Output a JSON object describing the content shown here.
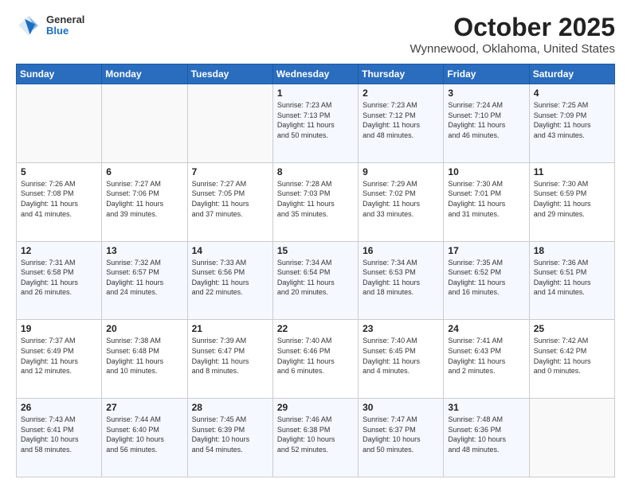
{
  "header": {
    "logo": {
      "general": "General",
      "blue": "Blue"
    },
    "title": "October 2025",
    "subtitle": "Wynnewood, Oklahoma, United States"
  },
  "weekdays": [
    "Sunday",
    "Monday",
    "Tuesday",
    "Wednesday",
    "Thursday",
    "Friday",
    "Saturday"
  ],
  "weeks": [
    [
      {
        "day": "",
        "info": ""
      },
      {
        "day": "",
        "info": ""
      },
      {
        "day": "",
        "info": ""
      },
      {
        "day": "1",
        "info": "Sunrise: 7:23 AM\nSunset: 7:13 PM\nDaylight: 11 hours\nand 50 minutes."
      },
      {
        "day": "2",
        "info": "Sunrise: 7:23 AM\nSunset: 7:12 PM\nDaylight: 11 hours\nand 48 minutes."
      },
      {
        "day": "3",
        "info": "Sunrise: 7:24 AM\nSunset: 7:10 PM\nDaylight: 11 hours\nand 46 minutes."
      },
      {
        "day": "4",
        "info": "Sunrise: 7:25 AM\nSunset: 7:09 PM\nDaylight: 11 hours\nand 43 minutes."
      }
    ],
    [
      {
        "day": "5",
        "info": "Sunrise: 7:26 AM\nSunset: 7:08 PM\nDaylight: 11 hours\nand 41 minutes."
      },
      {
        "day": "6",
        "info": "Sunrise: 7:27 AM\nSunset: 7:06 PM\nDaylight: 11 hours\nand 39 minutes."
      },
      {
        "day": "7",
        "info": "Sunrise: 7:27 AM\nSunset: 7:05 PM\nDaylight: 11 hours\nand 37 minutes."
      },
      {
        "day": "8",
        "info": "Sunrise: 7:28 AM\nSunset: 7:03 PM\nDaylight: 11 hours\nand 35 minutes."
      },
      {
        "day": "9",
        "info": "Sunrise: 7:29 AM\nSunset: 7:02 PM\nDaylight: 11 hours\nand 33 minutes."
      },
      {
        "day": "10",
        "info": "Sunrise: 7:30 AM\nSunset: 7:01 PM\nDaylight: 11 hours\nand 31 minutes."
      },
      {
        "day": "11",
        "info": "Sunrise: 7:30 AM\nSunset: 6:59 PM\nDaylight: 11 hours\nand 29 minutes."
      }
    ],
    [
      {
        "day": "12",
        "info": "Sunrise: 7:31 AM\nSunset: 6:58 PM\nDaylight: 11 hours\nand 26 minutes."
      },
      {
        "day": "13",
        "info": "Sunrise: 7:32 AM\nSunset: 6:57 PM\nDaylight: 11 hours\nand 24 minutes."
      },
      {
        "day": "14",
        "info": "Sunrise: 7:33 AM\nSunset: 6:56 PM\nDaylight: 11 hours\nand 22 minutes."
      },
      {
        "day": "15",
        "info": "Sunrise: 7:34 AM\nSunset: 6:54 PM\nDaylight: 11 hours\nand 20 minutes."
      },
      {
        "day": "16",
        "info": "Sunrise: 7:34 AM\nSunset: 6:53 PM\nDaylight: 11 hours\nand 18 minutes."
      },
      {
        "day": "17",
        "info": "Sunrise: 7:35 AM\nSunset: 6:52 PM\nDaylight: 11 hours\nand 16 minutes."
      },
      {
        "day": "18",
        "info": "Sunrise: 7:36 AM\nSunset: 6:51 PM\nDaylight: 11 hours\nand 14 minutes."
      }
    ],
    [
      {
        "day": "19",
        "info": "Sunrise: 7:37 AM\nSunset: 6:49 PM\nDaylight: 11 hours\nand 12 minutes."
      },
      {
        "day": "20",
        "info": "Sunrise: 7:38 AM\nSunset: 6:48 PM\nDaylight: 11 hours\nand 10 minutes."
      },
      {
        "day": "21",
        "info": "Sunrise: 7:39 AM\nSunset: 6:47 PM\nDaylight: 11 hours\nand 8 minutes."
      },
      {
        "day": "22",
        "info": "Sunrise: 7:40 AM\nSunset: 6:46 PM\nDaylight: 11 hours\nand 6 minutes."
      },
      {
        "day": "23",
        "info": "Sunrise: 7:40 AM\nSunset: 6:45 PM\nDaylight: 11 hours\nand 4 minutes."
      },
      {
        "day": "24",
        "info": "Sunrise: 7:41 AM\nSunset: 6:43 PM\nDaylight: 11 hours\nand 2 minutes."
      },
      {
        "day": "25",
        "info": "Sunrise: 7:42 AM\nSunset: 6:42 PM\nDaylight: 11 hours\nand 0 minutes."
      }
    ],
    [
      {
        "day": "26",
        "info": "Sunrise: 7:43 AM\nSunset: 6:41 PM\nDaylight: 10 hours\nand 58 minutes."
      },
      {
        "day": "27",
        "info": "Sunrise: 7:44 AM\nSunset: 6:40 PM\nDaylight: 10 hours\nand 56 minutes."
      },
      {
        "day": "28",
        "info": "Sunrise: 7:45 AM\nSunset: 6:39 PM\nDaylight: 10 hours\nand 54 minutes."
      },
      {
        "day": "29",
        "info": "Sunrise: 7:46 AM\nSunset: 6:38 PM\nDaylight: 10 hours\nand 52 minutes."
      },
      {
        "day": "30",
        "info": "Sunrise: 7:47 AM\nSunset: 6:37 PM\nDaylight: 10 hours\nand 50 minutes."
      },
      {
        "day": "31",
        "info": "Sunrise: 7:48 AM\nSunset: 6:36 PM\nDaylight: 10 hours\nand 48 minutes."
      },
      {
        "day": "",
        "info": ""
      }
    ]
  ]
}
